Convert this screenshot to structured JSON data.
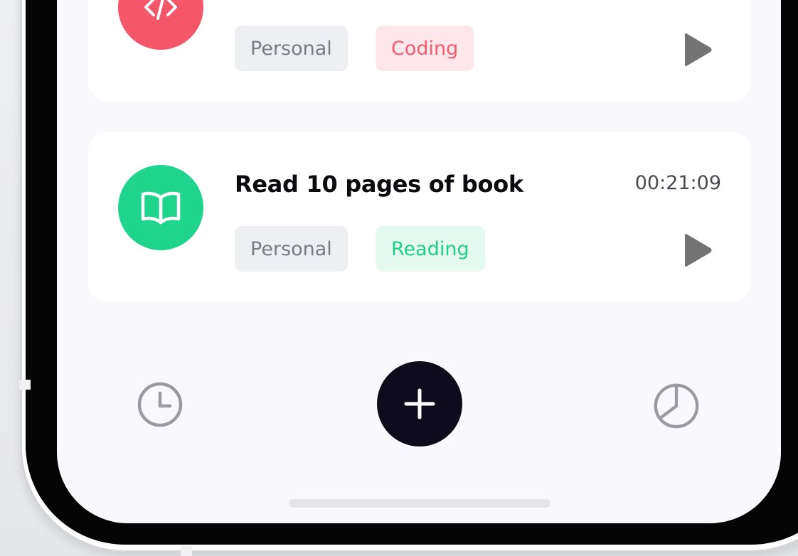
{
  "tasks": [
    {
      "title": "",
      "time": "",
      "tags": [
        "Personal",
        "Coding"
      ],
      "icon": "code-icon",
      "accent": "#f4566a",
      "tag_bg": "#fde7ea"
    },
    {
      "title": "Read 10 pages of book",
      "time": "00:21:09",
      "tags": [
        "Personal",
        "Reading"
      ],
      "icon": "book-icon",
      "accent": "#1fd58e",
      "tag_bg": "#e4f9f0"
    }
  ],
  "nav": {
    "left_icon": "clock-icon",
    "center_icon": "plus-icon",
    "right_icon": "pie-chart-icon"
  }
}
